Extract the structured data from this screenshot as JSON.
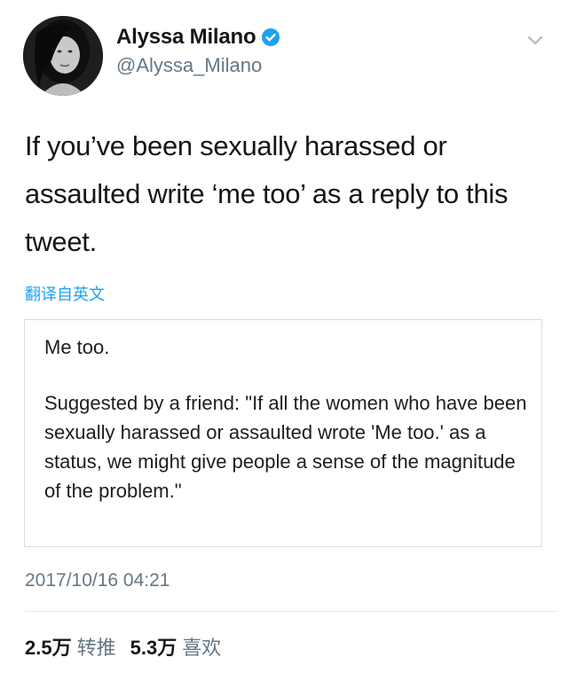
{
  "author": {
    "display_name": "Alyssa Milano",
    "handle": "@Alyssa_Milano",
    "verified": true
  },
  "tweet": {
    "text": "If you’ve been sexually harassed or assaulted write ‘me too’ as a reply to this tweet.",
    "translate_link": "翻译自英文"
  },
  "quoted_note": {
    "line1": "Me too.",
    "body": "Suggested by a friend: \"If all the women who have been sexually harassed or assaulted wrote 'Me too.' as a status, we might give people a sense of the magnitude of the problem.\""
  },
  "timestamp": "2017/10/16 04:21",
  "stats": {
    "retweets_count": "2.5万",
    "retweets_label": "转推",
    "likes_count": "5.3万",
    "likes_label": "喜欢"
  },
  "colors": {
    "link_blue": "#1da1f2",
    "secondary_text": "#657786",
    "primary_text": "#14171a"
  },
  "icons": {
    "verified": "verified-badge-icon",
    "menu": "chevron-down-icon"
  }
}
